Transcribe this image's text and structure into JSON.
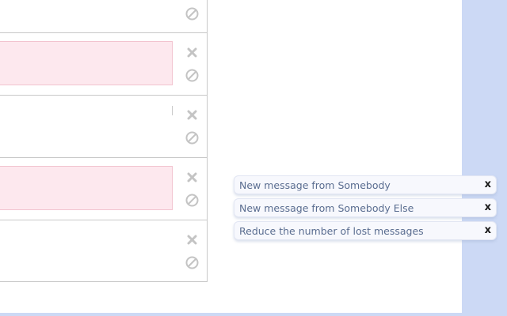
{
  "messages": [
    {
      "highlighted": false,
      "actions": {
        "block_icon": "block-icon"
      }
    },
    {
      "highlighted": true,
      "actions": {
        "delete_icon": "delete-icon",
        "block_icon": "block-icon"
      }
    },
    {
      "highlighted": false,
      "actions": {
        "delete_icon": "delete-icon",
        "block_icon": "block-icon"
      }
    },
    {
      "highlighted": true,
      "actions": {
        "delete_icon": "delete-icon",
        "block_icon": "block-icon"
      }
    },
    {
      "highlighted": false,
      "actions": {
        "delete_icon": "delete-icon",
        "block_icon": "block-icon"
      }
    }
  ],
  "notifications": [
    {
      "text": "New message from Somebody",
      "close_label": "x"
    },
    {
      "text": "New message from Somebody Else",
      "close_label": "x"
    },
    {
      "text": "Reduce the number of lost messages",
      "close_label": "x"
    }
  ],
  "colors": {
    "background": "#ccd9f5",
    "highlight": "#fde8ee",
    "icon": "#c4c4c4",
    "notification_text": "#5a6d90"
  }
}
